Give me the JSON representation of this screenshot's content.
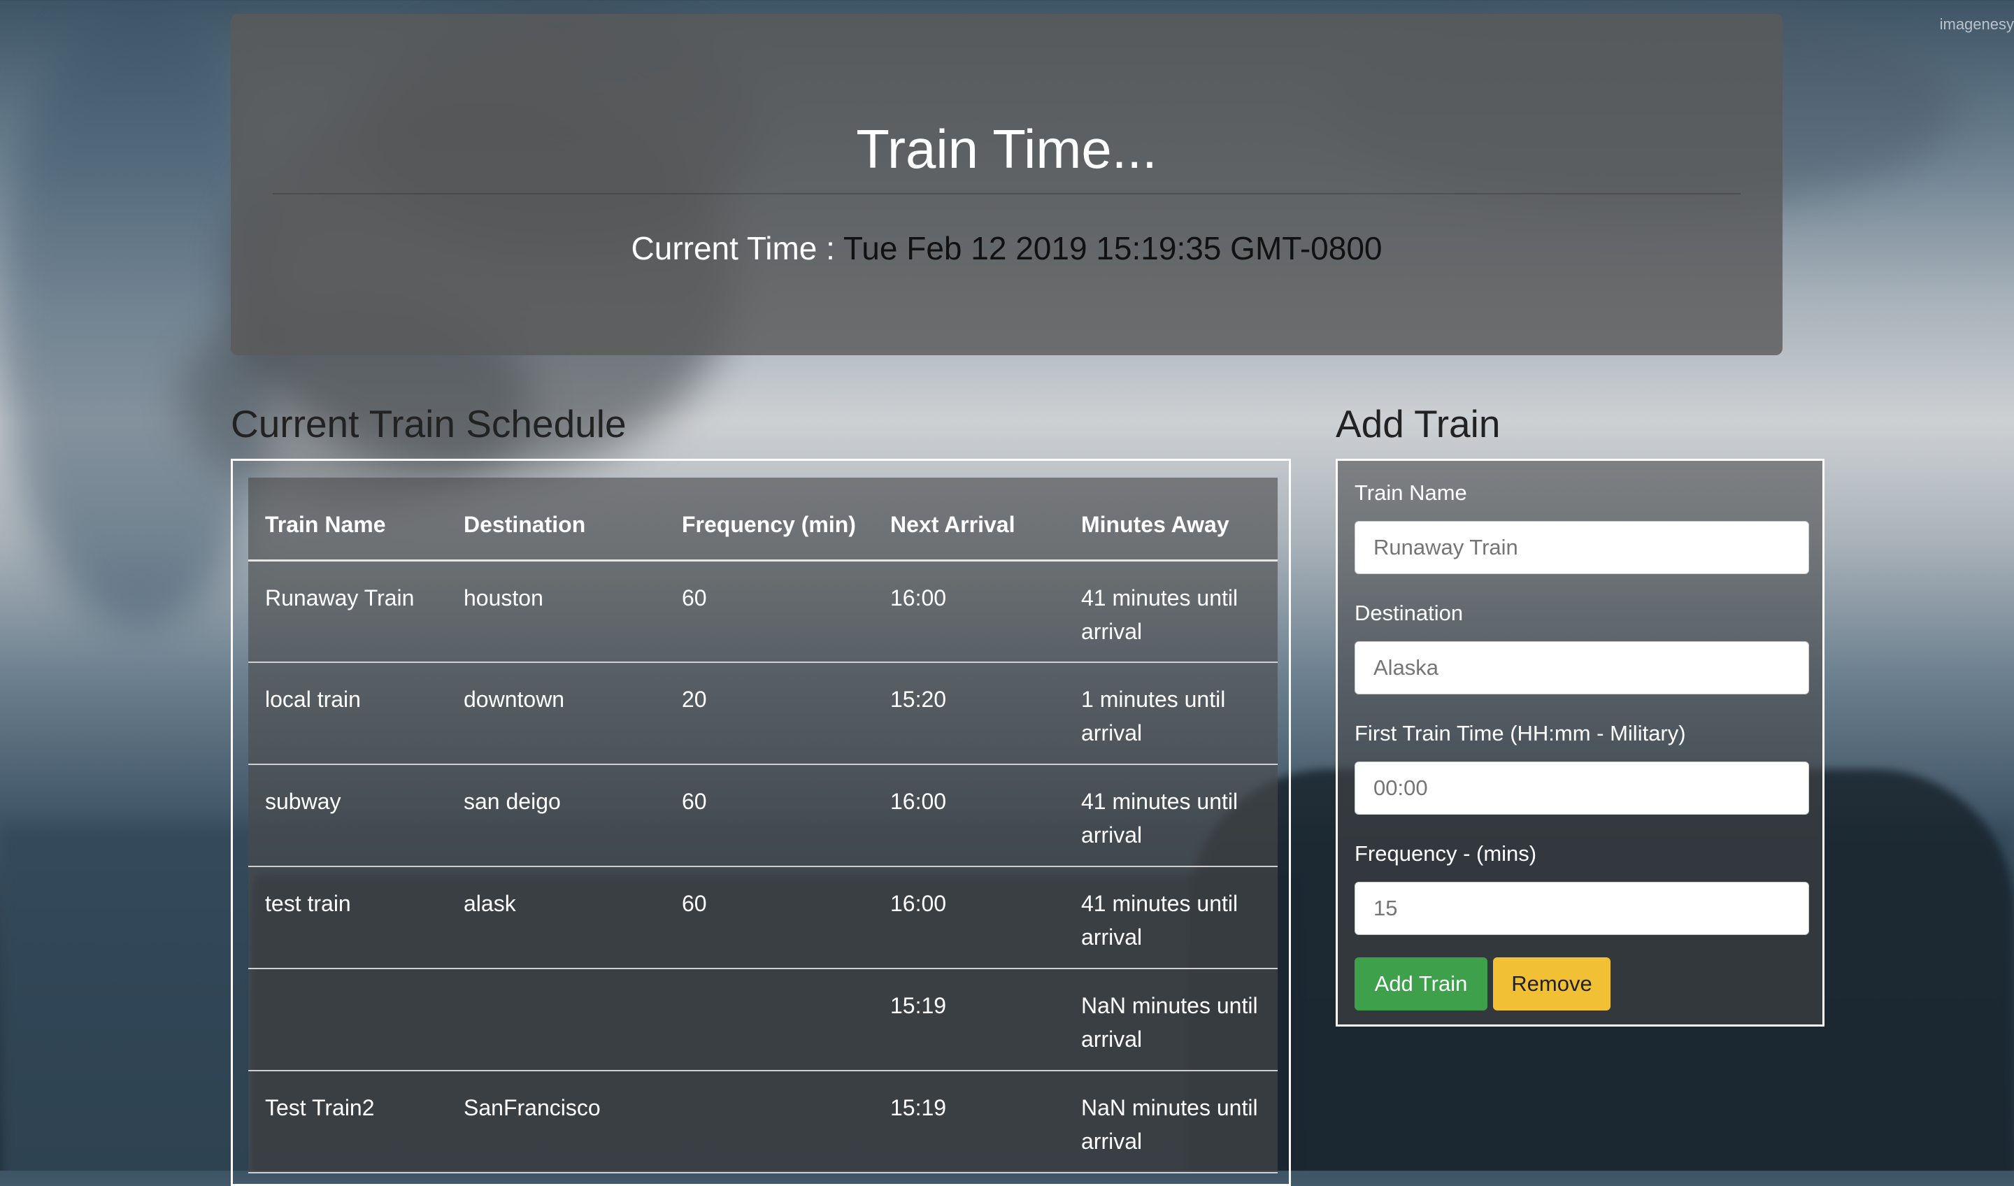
{
  "watermark": "imagenesy",
  "jumbotron": {
    "title": "Train Time...",
    "clock_label": "Current Time :",
    "clock_value": "Tue Feb 12 2019 15:19:35 GMT-0800"
  },
  "schedule": {
    "title": "Current Train Schedule",
    "headers": [
      "Train Name",
      "Destination",
      "Frequency (min)",
      "Next Arrival",
      "Minutes Away"
    ],
    "rows": [
      [
        "Runaway Train",
        "houston",
        "60",
        "16:00",
        "41 minutes until arrival"
      ],
      [
        "local train",
        "downtown",
        "20",
        "15:20",
        "1 minutes until arrival"
      ],
      [
        "subway",
        "san deigo",
        "60",
        "16:00",
        "41 minutes until arrival"
      ],
      [
        "test train",
        "alask",
        "60",
        "16:00",
        "41 minutes until arrival"
      ],
      [
        "",
        "",
        "",
        "15:19",
        "NaN minutes until arrival"
      ],
      [
        "Test Train2",
        "SanFrancisco",
        "",
        "15:19",
        "NaN minutes until arrival"
      ]
    ]
  },
  "form": {
    "title": "Add Train",
    "name_label": "Train Name",
    "name_placeholder": "Runaway Train",
    "destination_label": "Destination",
    "destination_placeholder": "Alaska",
    "first_time_label": "First Train Time (HH:mm - Military)",
    "first_time_placeholder": "00:00",
    "frequency_label": "Frequency - (mins)",
    "frequency_placeholder": "15",
    "add_button": "Add Train",
    "remove_button": "Remove"
  }
}
